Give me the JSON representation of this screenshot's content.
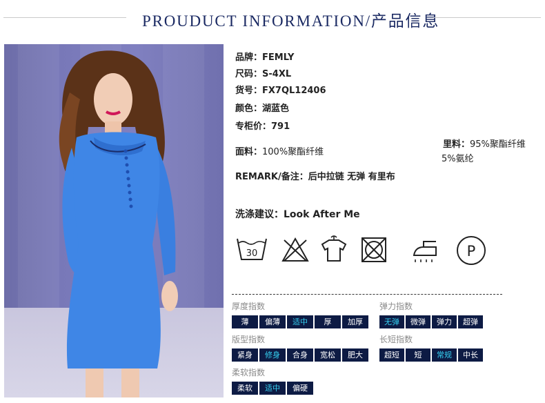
{
  "header": {
    "title": "PROUDUCT INFORMATION/产品信息"
  },
  "specs": {
    "brand": {
      "label": "品牌：",
      "value": "FEMLY"
    },
    "size": {
      "label": "尺码：",
      "value": "S-4XL"
    },
    "item_no": {
      "label": "货号：",
      "value": "FX7QL12406"
    },
    "color": {
      "label": "颜色：",
      "value": "湖蓝色"
    },
    "price": {
      "label": "专柜价：",
      "value": "791"
    },
    "fabric": {
      "label": "面料：",
      "value": "100%聚酯纤维"
    },
    "lining": {
      "label": "里料：",
      "value": "95%聚酯纤维",
      "value2": "5%氨纶"
    },
    "remark": {
      "label": "REMARK/备注：",
      "value": "后中拉链 无弹 有里布"
    },
    "wash": {
      "label": "洗涤建议：",
      "value": "Look After Me"
    }
  },
  "care_icons": [
    {
      "name": "wash-30-icon",
      "text": "30"
    },
    {
      "name": "no-bleach-icon"
    },
    {
      "name": "hang-dry-icon"
    },
    {
      "name": "no-tumble-dry-icon"
    },
    {
      "name": "iron-icon"
    },
    {
      "name": "dry-clean-p-icon",
      "text": "P"
    }
  ],
  "indices": {
    "thickness": {
      "title": "厚度指数",
      "options": [
        "薄",
        "偏薄",
        "适中",
        "厚",
        "加厚"
      ],
      "selected": "适中"
    },
    "elasticity": {
      "title": "弹力指数",
      "options": [
        "无弹",
        "微弹",
        "弹力",
        "超弹"
      ],
      "selected": "无弹"
    },
    "fit": {
      "title": "版型指数",
      "options": [
        "紧身",
        "修身",
        "合身",
        "宽松",
        "肥大"
      ],
      "selected": "修身"
    },
    "length": {
      "title": "长短指数",
      "options": [
        "超短",
        "短",
        "常规",
        "中长"
      ],
      "selected": "常规"
    },
    "softness": {
      "title": "柔软指数",
      "options": [
        "柔软",
        "适中",
        "偏硬"
      ],
      "selected": "适中"
    }
  },
  "colors": {
    "header_text": "#1b2a63",
    "chip_bg": "#0d1b44",
    "chip_active_text": "#35d1f2",
    "dress": "#3f86e6"
  }
}
